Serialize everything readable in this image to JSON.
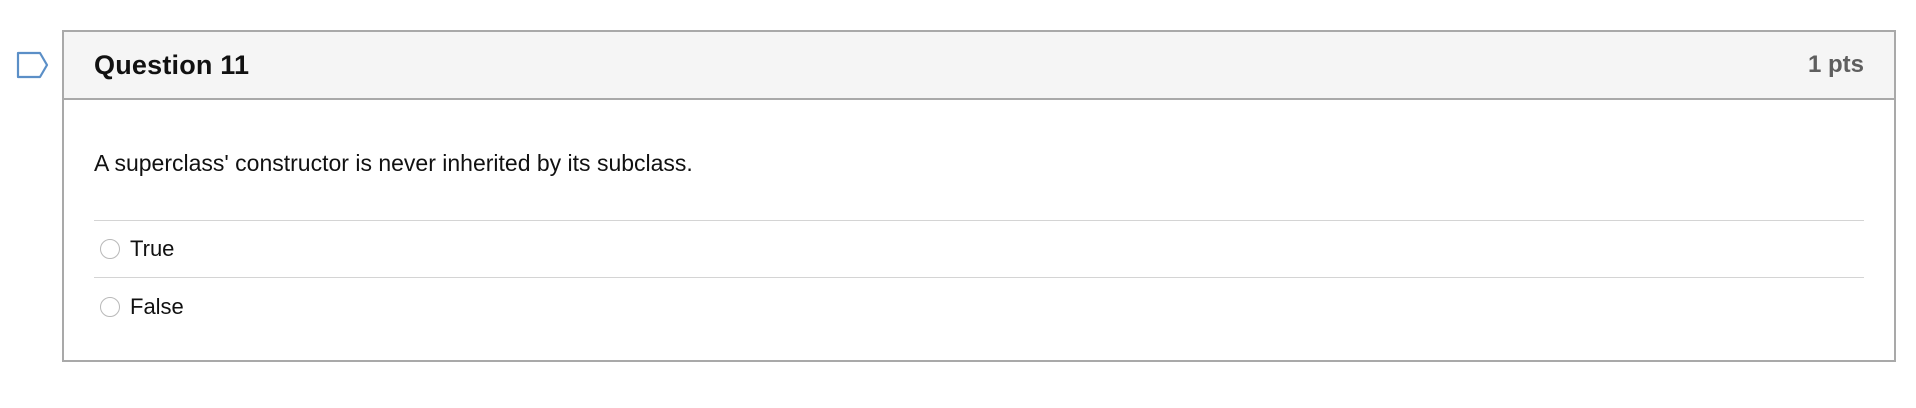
{
  "question": {
    "title": "Question 11",
    "points": "1 pts",
    "text": "A superclass' constructor is never inherited by its subclass.",
    "answers": [
      {
        "label": "True",
        "selected": false
      },
      {
        "label": "False",
        "selected": false
      }
    ]
  },
  "icons": {
    "flag": "flag-question-icon"
  },
  "colors": {
    "header_background": "#f5f5f5",
    "card_border": "#a9a9a9",
    "flag_outline": "#5b8fc7",
    "points_text": "#5f5f5f"
  }
}
